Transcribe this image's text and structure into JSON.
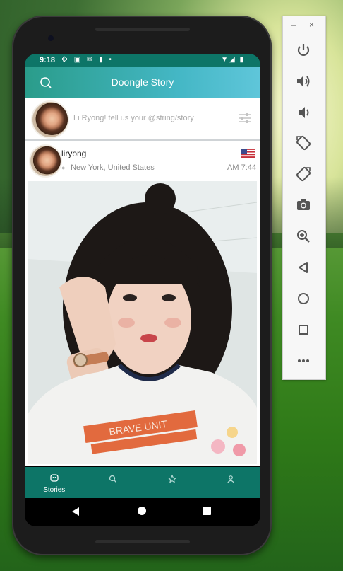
{
  "status_bar": {
    "time": "9:18",
    "left_icons": "⚙ ▣ ✉ ▮ •",
    "right_icons": "▼◢ ▮"
  },
  "app_bar": {
    "title": "Doongle Story",
    "logo_icon": "search-refresh-icon"
  },
  "compose": {
    "prompt": "Li Ryong! tell us your  @string/story",
    "filter_icon": "sliders-icon"
  },
  "post": {
    "author": "liryong",
    "location_city": "New York,",
    "location_country": "United States",
    "time": "AM 7:44",
    "flag_icon": "us-flag-icon"
  },
  "bottom_nav": {
    "tabs": [
      {
        "label": "Stories",
        "icon": "stories-icon",
        "active": true
      },
      {
        "label": "",
        "icon": "search-icon",
        "active": false
      },
      {
        "label": "",
        "icon": "star-icon",
        "active": false
      },
      {
        "label": "",
        "icon": "person-icon",
        "active": false
      }
    ]
  },
  "emulator_panel": {
    "minimize": "–",
    "close": "×",
    "buttons": [
      "power-icon",
      "volume-up-icon",
      "volume-down-icon",
      "rotate-left-icon",
      "rotate-right-icon",
      "camera-icon",
      "zoom-icon",
      "back-icon",
      "home-icon",
      "overview-icon",
      "more-icon"
    ]
  },
  "colors": {
    "primary_dark": "#0d7567",
    "appbar_start": "#2a9c8a",
    "appbar_end": "#5fc6da"
  }
}
